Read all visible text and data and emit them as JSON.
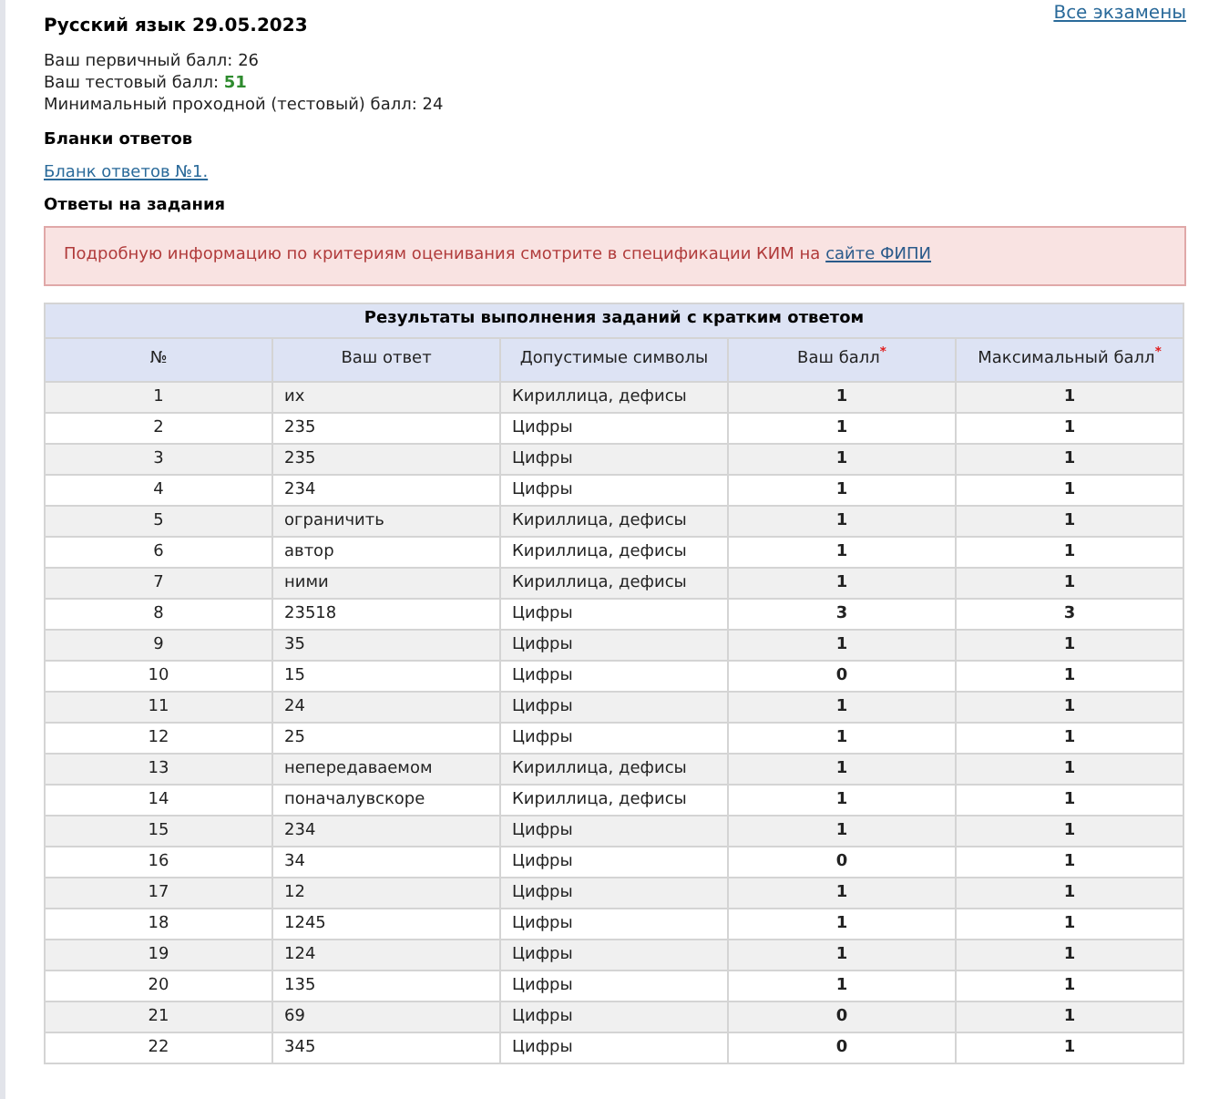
{
  "all_exams_link": "Все экзамены",
  "title": "Русский язык 29.05.2023",
  "scores": [
    {
      "label": "Ваш первичный балл:",
      "value": "26",
      "highlight": false
    },
    {
      "label": "Ваш тестовый балл:",
      "value": "51",
      "highlight": true
    },
    {
      "label": "Минимальный проходной (тестовый) балл:",
      "value": "24",
      "highlight": false
    }
  ],
  "forms_heading": "Бланки ответов",
  "form_link": "Бланк ответов №1.",
  "answers_heading": "Ответы на задания",
  "notice": {
    "text": "Подробную информацию по критериям оценивания смотрите в спецификации КИМ на",
    "link": "сайте ФИПИ"
  },
  "table": {
    "title": "Результаты выполнения заданий с кратким ответом",
    "columns": [
      {
        "label": "№"
      },
      {
        "label": "Ваш ответ"
      },
      {
        "label": "Допустимые символы"
      },
      {
        "label": "Ваш балл",
        "mark": "*"
      },
      {
        "label": "Максимальный балл",
        "mark": "*"
      }
    ],
    "rows": [
      {
        "n": "1",
        "answer": "их",
        "allowed": "Кириллица, дефисы",
        "score": "1",
        "max": "1"
      },
      {
        "n": "2",
        "answer": "235",
        "allowed": "Цифры",
        "score": "1",
        "max": "1"
      },
      {
        "n": "3",
        "answer": "235",
        "allowed": "Цифры",
        "score": "1",
        "max": "1"
      },
      {
        "n": "4",
        "answer": "234",
        "allowed": "Цифры",
        "score": "1",
        "max": "1"
      },
      {
        "n": "5",
        "answer": "ограничить",
        "allowed": "Кириллица, дефисы",
        "score": "1",
        "max": "1"
      },
      {
        "n": "6",
        "answer": "автор",
        "allowed": "Кириллица, дефисы",
        "score": "1",
        "max": "1"
      },
      {
        "n": "7",
        "answer": "ними",
        "allowed": "Кириллица, дефисы",
        "score": "1",
        "max": "1"
      },
      {
        "n": "8",
        "answer": "23518",
        "allowed": "Цифры",
        "score": "3",
        "max": "3"
      },
      {
        "n": "9",
        "answer": "35",
        "allowed": "Цифры",
        "score": "1",
        "max": "1"
      },
      {
        "n": "10",
        "answer": "15",
        "allowed": "Цифры",
        "score": "0",
        "max": "1"
      },
      {
        "n": "11",
        "answer": "24",
        "allowed": "Цифры",
        "score": "1",
        "max": "1"
      },
      {
        "n": "12",
        "answer": "25",
        "allowed": "Цифры",
        "score": "1",
        "max": "1"
      },
      {
        "n": "13",
        "answer": "непередаваемом",
        "allowed": "Кириллица, дефисы",
        "score": "1",
        "max": "1"
      },
      {
        "n": "14",
        "answer": "поначалувскоре",
        "allowed": "Кириллица, дефисы",
        "score": "1",
        "max": "1"
      },
      {
        "n": "15",
        "answer": "234",
        "allowed": "Цифры",
        "score": "1",
        "max": "1"
      },
      {
        "n": "16",
        "answer": "34",
        "allowed": "Цифры",
        "score": "0",
        "max": "1"
      },
      {
        "n": "17",
        "answer": "12",
        "allowed": "Цифры",
        "score": "1",
        "max": "1"
      },
      {
        "n": "18",
        "answer": "1245",
        "allowed": "Цифры",
        "score": "1",
        "max": "1"
      },
      {
        "n": "19",
        "answer": "124",
        "allowed": "Цифры",
        "score": "1",
        "max": "1"
      },
      {
        "n": "20",
        "answer": "135",
        "allowed": "Цифры",
        "score": "1",
        "max": "1"
      },
      {
        "n": "21",
        "answer": "69",
        "allowed": "Цифры",
        "score": "0",
        "max": "1"
      },
      {
        "n": "22",
        "answer": "345",
        "allowed": "Цифры",
        "score": "0",
        "max": "1"
      }
    ]
  }
}
